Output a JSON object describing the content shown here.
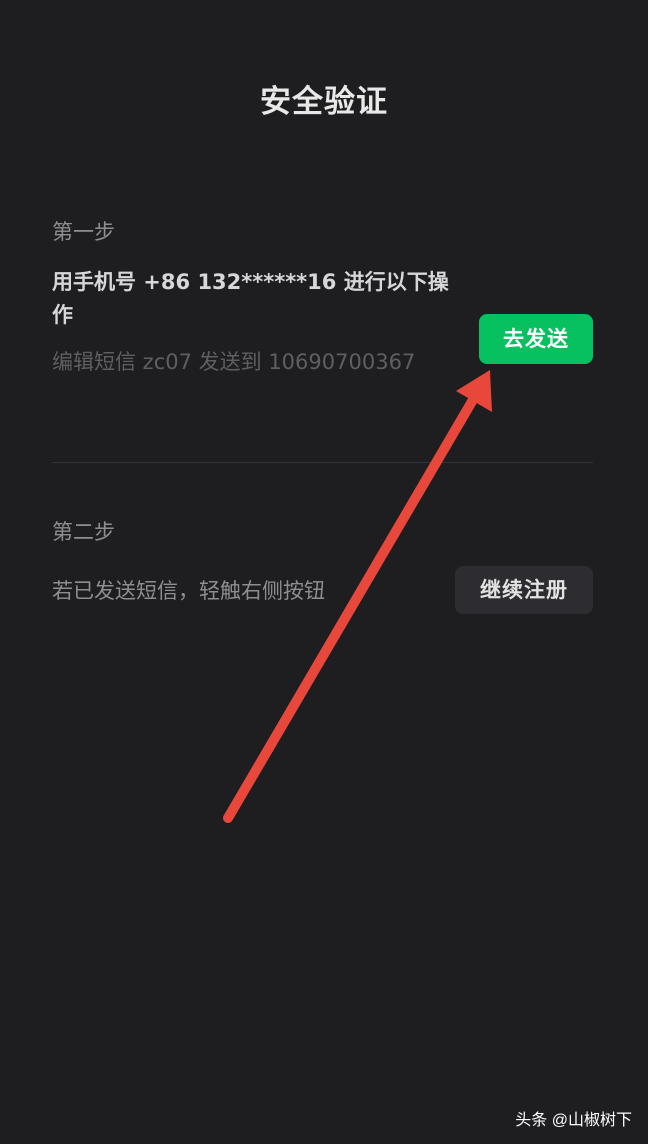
{
  "header": {
    "title": "安全验证"
  },
  "step1": {
    "label": "第一步",
    "instruction": "用手机号 +86 132******16 进行以下操作",
    "sms_detail": "编辑短信 zc07 发送到 10690700367",
    "send_button": "去发送"
  },
  "step2": {
    "label": "第二步",
    "hint": "若已发送短信，轻触右侧按钮",
    "continue_button": "继续注册"
  },
  "watermark": "头条 @山椒树下",
  "colors": {
    "background": "#1e1d20",
    "primary_green": "#07c160",
    "secondary_button": "#2d2c30",
    "annotation_arrow": "#e8473b"
  },
  "annotation": {
    "icon": "red-arrow-icon"
  }
}
